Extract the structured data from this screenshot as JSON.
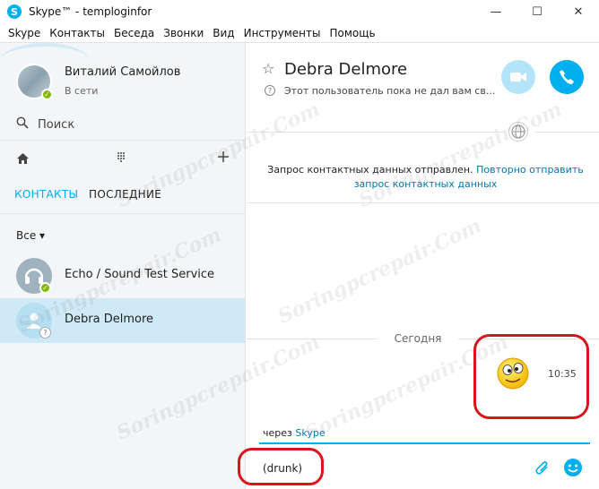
{
  "window": {
    "title": "Skype™ - temploginfor",
    "logo_letter": "S",
    "minimize_glyph": "—",
    "maximize_glyph": "☐",
    "close_glyph": "✕"
  },
  "menu": [
    "Skype",
    "Контакты",
    "Беседа",
    "Звонки",
    "Вид",
    "Инструменты",
    "Помощь"
  ],
  "profile": {
    "name": "Виталий Самойлов",
    "status": "В сети"
  },
  "sidebar": {
    "search_label": "Поиск",
    "tabs": {
      "contacts": "КОНТАКТЫ",
      "recent": "ПОСЛЕДНИЕ"
    },
    "filter_label": "Все ▾",
    "contacts": [
      {
        "name": "Echo / Sound Test Service",
        "status": "online"
      },
      {
        "name": "Debra Delmore",
        "status": "pending"
      }
    ]
  },
  "chat": {
    "contact_name": "Debra Delmore",
    "contact_subtitle": "Этот пользователь пока не дал вам св...",
    "request_text": "Запрос контактных данных отправлен.",
    "request_link": "Повторно отправить запрос контактных данных",
    "day_separator": "Сегодня",
    "message_time": "10:35",
    "message_emoticon": "drunk",
    "via_prefix": "через",
    "via_link": "Skype",
    "input_value": "(drunk)"
  },
  "colors": {
    "accent": "#00aff0",
    "selected_row": "#cfe9f7",
    "highlight_circle": "#d9141b",
    "online": "#7fba00"
  },
  "icons": [
    "search-icon",
    "home-icon",
    "dialpad-icon",
    "add-icon",
    "star-icon",
    "video-call-icon",
    "call-icon",
    "globe-icon",
    "attach-icon",
    "emoji-icon"
  ],
  "watermark": "Soringpcrepair.Com"
}
